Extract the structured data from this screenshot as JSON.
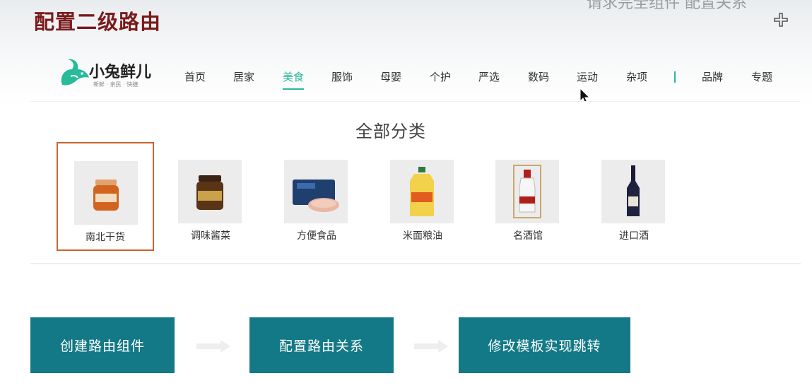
{
  "slide": {
    "title": "配置二级路由",
    "top_right_partial": "请求完全组件 配置关系"
  },
  "logo": {
    "name": "小兔鲜儿",
    "slogan": "新鲜 · 亲民 · 快捷",
    "icon": "rabbit-icon",
    "brand_color": "#27ba9b"
  },
  "nav": {
    "items": [
      {
        "label": "首页"
      },
      {
        "label": "居家"
      },
      {
        "label": "美食"
      },
      {
        "label": "服饰"
      },
      {
        "label": "母婴"
      },
      {
        "label": "个护"
      },
      {
        "label": "严选"
      },
      {
        "label": "数码"
      },
      {
        "label": "运动"
      },
      {
        "label": "杂项"
      },
      {
        "label": "品牌"
      },
      {
        "label": "专题"
      }
    ],
    "active": "美食",
    "active_color": "#27ba9b"
  },
  "category_panel": {
    "title": "全部分类",
    "items": [
      {
        "label": "南北干货",
        "icon": "jar-icon",
        "selected": true
      },
      {
        "label": "调味酱菜",
        "icon": "sauce-jar-icon",
        "selected": false
      },
      {
        "label": "方便食品",
        "icon": "ham-pack-icon",
        "selected": false
      },
      {
        "label": "米面粮油",
        "icon": "oil-bottle-icon",
        "selected": false
      },
      {
        "label": "名酒馆",
        "icon": "liquor-bottle-icon",
        "selected": false
      },
      {
        "label": "进口酒",
        "icon": "wine-bottle-icon",
        "selected": false
      }
    ],
    "selected_border_color": "#c8652e"
  },
  "flow": {
    "steps": [
      {
        "label": "创建路由组件"
      },
      {
        "label": "配置路由关系"
      },
      {
        "label": "修改模板实现跳转"
      }
    ],
    "step_color": "#137986"
  }
}
